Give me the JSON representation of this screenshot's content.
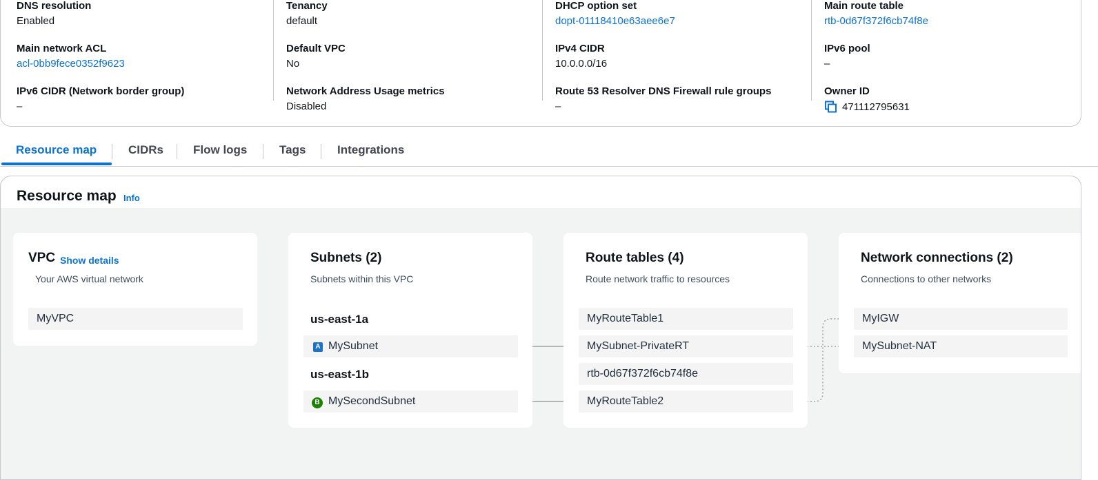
{
  "details": {
    "col1": [
      {
        "key": "DNS resolution",
        "value": "Enabled"
      },
      {
        "key": "Main network ACL",
        "value": "acl-0bb9fece0352f9623"
      },
      {
        "key": "IPv6 CIDR (Network border group)",
        "value": "–"
      }
    ],
    "col2": [
      {
        "key": "Tenancy",
        "value": "default"
      },
      {
        "key": "Default VPC",
        "value": "No"
      },
      {
        "key": "Network Address Usage metrics",
        "value": "Disabled"
      }
    ],
    "col3": [
      {
        "key": "DHCP option set",
        "value": "dopt-01118410e63aee6e7"
      },
      {
        "key": "IPv4 CIDR",
        "value": "10.0.0.0/16"
      },
      {
        "key": "Route 53 Resolver DNS Firewall rule groups",
        "value": "–"
      }
    ],
    "col4": [
      {
        "key": "Main route table",
        "value": "rtb-0d67f372f6cb74f8e"
      },
      {
        "key": "IPv6 pool",
        "value": "–"
      },
      {
        "key": "Owner ID",
        "value": "471112795631"
      }
    ]
  },
  "tabs": [
    {
      "label": "Resource map"
    },
    {
      "label": "CIDRs"
    },
    {
      "label": "Flow logs"
    },
    {
      "label": "Tags"
    },
    {
      "label": "Integrations"
    }
  ],
  "resource_map": {
    "title": "Resource map",
    "info": "Info",
    "vpc": {
      "title": "VPC",
      "show_details": "Show details",
      "subtitle": "Your AWS virtual network",
      "item": "MyVPC"
    },
    "subnets": {
      "title": "Subnets (2)",
      "subtitle": "Subnets within this VPC",
      "az1": "us-east-1a",
      "az1_badge": "A",
      "subnet1": "MySubnet",
      "az2": "us-east-1b",
      "az2_badge": "B",
      "subnet2": "MySecondSubnet"
    },
    "route_tables": {
      "title": "Route tables (4)",
      "subtitle": "Route network traffic to resources",
      "items": [
        "MyRouteTable1",
        "MySubnet-PrivateRT",
        "rtb-0d67f372f6cb74f8e",
        "MyRouteTable2"
      ]
    },
    "network_connections": {
      "title": "Network connections (2)",
      "subtitle": "Connections to other networks",
      "items": [
        "MyIGW",
        "MySubnet-NAT"
      ]
    }
  },
  "colors": {
    "link": "#0972d3",
    "badge_a": "#1a73c8",
    "badge_b": "#1d8102",
    "canvas": "#f2f3f3"
  }
}
